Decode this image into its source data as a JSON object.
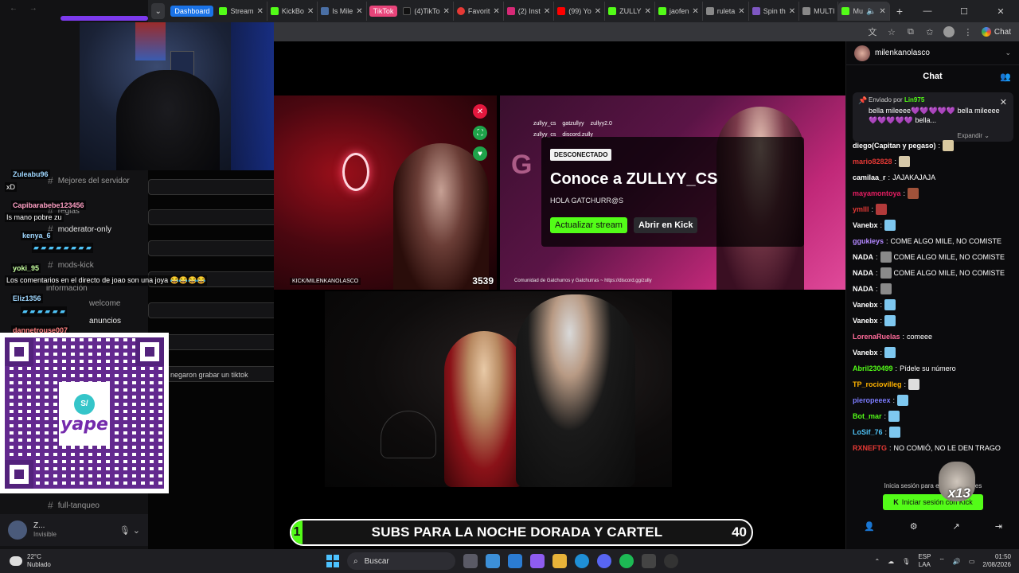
{
  "browser": {
    "tabs": [
      {
        "label": "Dashboard",
        "type": "group",
        "color": "#1a73e8"
      },
      {
        "label": "Stream",
        "color": "#53fc18"
      },
      {
        "label": "KickBo",
        "color": "#53fc18"
      },
      {
        "label": "Is Mile",
        "color": "#4a6fa5"
      },
      {
        "label": "TikTok",
        "type": "group",
        "color": "#e8447a"
      },
      {
        "label": "(4)TikTo",
        "color": "#111111"
      },
      {
        "label": "Favorit",
        "color": "#e53935"
      },
      {
        "label": "(2) Inst",
        "color": "#d62976"
      },
      {
        "label": "(99) Yo",
        "color": "#ff0000"
      },
      {
        "label": "ZULLY",
        "color": "#53fc18"
      },
      {
        "label": "jaofen",
        "color": "#53fc18"
      },
      {
        "label": "ruleta",
        "color": "#888888"
      },
      {
        "label": "Spin th",
        "color": "#7e57c2"
      },
      {
        "label": "MULTI",
        "color": "#888888"
      },
      {
        "label": "Mu",
        "color": "#53fc18",
        "active": true
      }
    ],
    "chat_button": "Chat"
  },
  "discord": {
    "channels": [
      {
        "label": "Mejores del servidor"
      },
      {
        "label": "reglas"
      },
      {
        "label": "moderator-only"
      },
      {
        "label": "mods-kick"
      },
      {
        "label": "información"
      },
      {
        "label": "welcome"
      },
      {
        "label": "anuncios"
      },
      {
        "label": "full-tanqueo"
      }
    ],
    "overlay_chat": [
      {
        "user": "Zuleabu96",
        "msg": "xD"
      },
      {
        "user": "Capibarabebe123456",
        "msg": "Is mano pobre zu"
      },
      {
        "user": "kenya_6",
        "msg": ""
      },
      {
        "user": "yoki_95",
        "msg": "Los comentarios en el directo de joao son una joya 😂😂😂😂"
      },
      {
        "user": "Eliz1356",
        "msg": ""
      },
      {
        "user": "dannetrouse007",
        "msg": "negaron grabar un tiktok"
      }
    ],
    "user": {
      "name": "Z...",
      "status": "Invisible"
    },
    "qr_label": "yape",
    "qr_badge": "S/"
  },
  "streams": {
    "a": {
      "tag": "KICK/MILENKANOLASCO",
      "viewers": "3539"
    },
    "b": {
      "socials": [
        "zullyy_cs",
        "gatzullyy",
        "zullyy2.0",
        "zullyy_cs",
        "discord.zully"
      ],
      "footer": "Comunidad de Gatchurros y Gatchurras ~ https://discord.gg/zully",
      "offline_badge": "DESCONECTADO",
      "title": "Conoce a ZULLYY_CS",
      "subtitle": "HOLA GATCHURR@S",
      "primary_btn": "Actualizar stream",
      "secondary_btn": "Abrir en Kick"
    }
  },
  "subs_goal": {
    "text": "SUBS PARA LA NOCHE DORADA Y CARTEL",
    "current": "1",
    "goal": "40",
    "progress_fraction": 0.025
  },
  "kick_chat": {
    "channel": "milenkanolasco",
    "title": "Chat",
    "pinned": {
      "sent_by_label": "Enviado por",
      "sent_by": "Lin975",
      "message": "bella mileeee💜💜💜💜💜 bella mileeee💜💜💜💜💜 bella...",
      "expand": "Expandir"
    },
    "messages": [
      {
        "user": "diego(Capitan y pegaso)",
        "color": "#ffffff",
        "text": "",
        "emote": "#d9c9a0"
      },
      {
        "user": "mario82828",
        "color": "#e53935",
        "text": "",
        "emote": "#d6c8a8"
      },
      {
        "user": "camilaa_r",
        "color": "#ffffff",
        "text": "JAJAKAJAJA",
        "emote": ""
      },
      {
        "user": "mayamontoya",
        "color": "#e91e63",
        "text": "",
        "emote": "#a0523a"
      },
      {
        "user": "ymlll",
        "color": "#e53935",
        "text": "",
        "emote": "#b23a3a"
      },
      {
        "user": "Vanebx",
        "color": "#ffffff",
        "text": "",
        "emote": "#7ec8f0"
      },
      {
        "user": "ggukieys",
        "color": "#b388ff",
        "text": "COME ALGO MILE, NO COMISTE",
        "emote": ""
      },
      {
        "user": "NADA",
        "color": "#ffffff",
        "text": "COME ALGO MILE, NO COMISTE",
        "emote": "#8a8a8a"
      },
      {
        "user": "NADA",
        "color": "#ffffff",
        "text": "COME ALGO MILE, NO COMISTE",
        "emote": "#8a8a8a"
      },
      {
        "user": "NADA",
        "color": "#ffffff",
        "text": "",
        "emote": "#8a8a8a"
      },
      {
        "user": "Vanebx",
        "color": "#ffffff",
        "text": "",
        "emote": "#7ec8f0"
      },
      {
        "user": "Vanebx",
        "color": "#ffffff",
        "text": "",
        "emote": "#7ec8f0"
      },
      {
        "user": "LorenaRuelas",
        "color": "#ff6b9a",
        "text": "comeee",
        "emote": ""
      },
      {
        "user": "Vanebx",
        "color": "#ffffff",
        "text": "",
        "emote": "#7ec8f0"
      },
      {
        "user": "Abril230499",
        "color": "#53fc18",
        "text": "Pídele su número",
        "emote": ""
      },
      {
        "user": "TP_rociovilleg",
        "color": "#ffb300",
        "text": "",
        "emote": "#dddddd"
      },
      {
        "user": "pieropeeex",
        "color": "#7c7cff",
        "text": "",
        "emote": "#7ec8f0"
      },
      {
        "user": "Bot_mar",
        "color": "#53fc18",
        "text": "",
        "emote": "#7ec8f0"
      },
      {
        "user": "LoSif_76",
        "color": "#4fc3f7",
        "text": "",
        "emote": "#7ec8f0"
      },
      {
        "user": "RXNEFTG",
        "color": "#e53935",
        "text": "NO COMIÓ, NO LE DEN TRAGO",
        "emote": ""
      }
    ],
    "footer_hint": "Inicia sesión para enviar mensajes",
    "login_btn": "Iniciar sesión con Kick",
    "gift_overlay": "x13"
  },
  "taskbar": {
    "weather_temp": "22°C",
    "weather_desc": "Nublado",
    "search": "Buscar",
    "lang_1": "ESP",
    "lang_2": "LAA",
    "time": "01:50",
    "date": "2/08/2026"
  }
}
